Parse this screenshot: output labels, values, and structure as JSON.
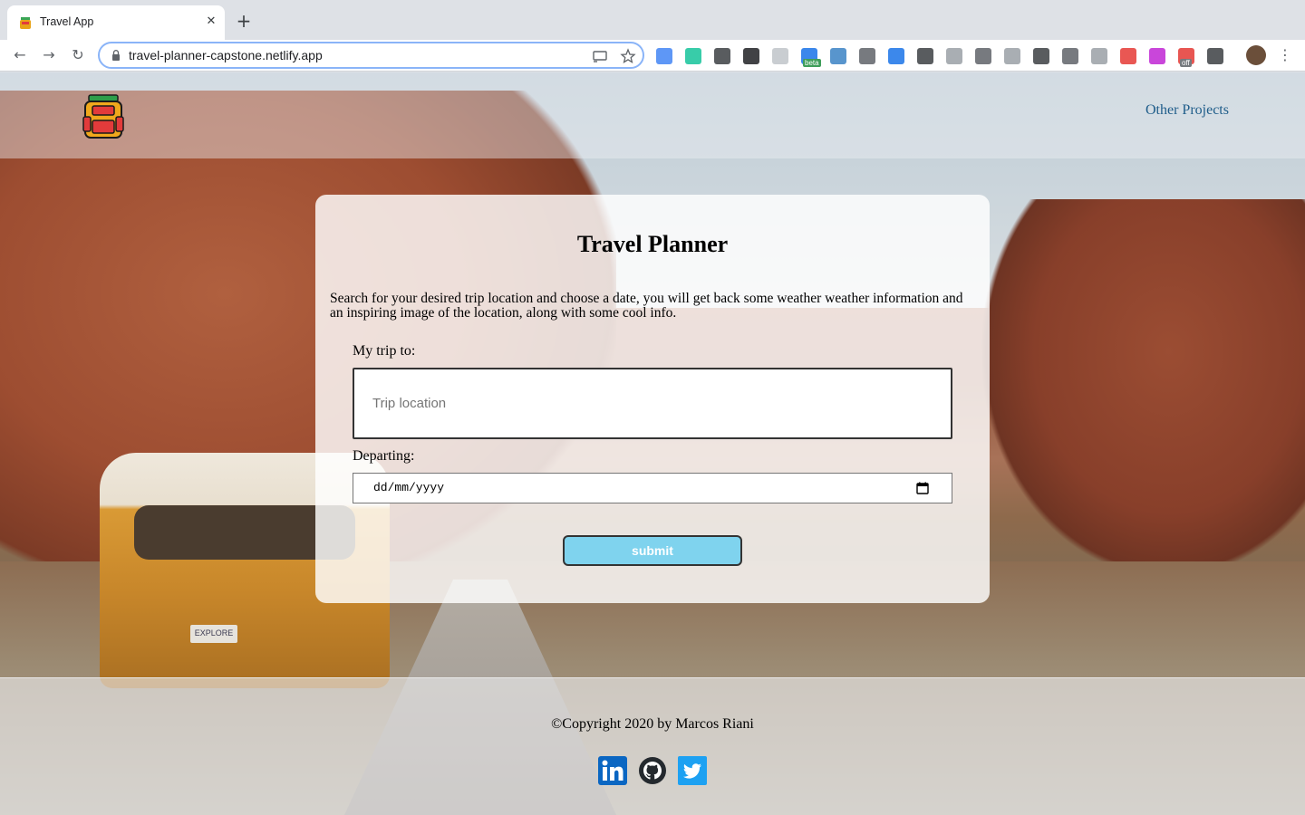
{
  "browser": {
    "tab_title": "Travel App",
    "tab_close_glyph": "✕",
    "new_tab_glyph": "+",
    "url": "travel-planner-capstone.netlify.app",
    "nav": {
      "back_glyph": "←",
      "forward_glyph": "→",
      "reload_glyph": "↻"
    },
    "extensions": [
      {
        "name": "google-translate-icon",
        "color": "#4285f4"
      },
      {
        "name": "grammarly-icon",
        "color": "#15c39a"
      },
      {
        "name": "screenshot-icon",
        "color": "#3c4043"
      },
      {
        "name": "whatfont-icon",
        "color": "#202124"
      },
      {
        "name": "grid-icon",
        "color": "#c0c4c9"
      },
      {
        "name": "beta-extension-icon",
        "color": "#1a73e8",
        "badge": "beta"
      },
      {
        "name": "safari-compass-icon",
        "color": "#3b82c4"
      },
      {
        "name": "books-icon",
        "color": "#5f6368"
      },
      {
        "name": "crop-icon",
        "color": "#1a73e8"
      },
      {
        "name": "eyedropper-icon",
        "color": "#3c4043"
      },
      {
        "name": "vue-devtools-icon",
        "color": "#9aa0a6"
      },
      {
        "name": "camera-icon",
        "color": "#5f6368"
      },
      {
        "name": "message-icon",
        "color": "#9aa0a6"
      },
      {
        "name": "reader-icon",
        "color": "#3c4043"
      },
      {
        "name": "bug-icon",
        "color": "#5f6368"
      },
      {
        "name": "page-ruler-icon",
        "color": "#9aa0a6"
      },
      {
        "name": "color-picker-icon",
        "color": "#e53935"
      },
      {
        "name": "purple-circle-icon",
        "color": "#c026d3"
      },
      {
        "name": "off-extension-icon",
        "color": "#e53935",
        "badge": "off"
      },
      {
        "name": "playlist-icon",
        "color": "#3c4043"
      }
    ]
  },
  "header": {
    "logo_name": "backpack-logo",
    "other_projects": "Other Projects"
  },
  "form": {
    "title": "Travel Planner",
    "description": "Search for your desired trip location and choose a date, you will get back some weather weather information and an inspiring image of the location, along with some cool info.",
    "trip_label": "My trip to:",
    "trip_placeholder": "Trip location",
    "trip_value": "",
    "departing_label": "Departing:",
    "date_placeholder": "dd/mm/yyyy",
    "submit_label": "submit"
  },
  "background": {
    "plate_text": "EXPLORE"
  },
  "footer": {
    "copyright": "©Copyright 2020 by Marcos Riani",
    "social": [
      {
        "name": "linkedin-icon",
        "color": "#0a66c2"
      },
      {
        "name": "github-icon",
        "color": "#24292e"
      },
      {
        "name": "twitter-icon",
        "color": "#1da1f2"
      }
    ]
  },
  "colors": {
    "link": "#1f5d8a",
    "submit_bg": "#7fd3ee",
    "card_bg": "rgba(255,255,255,0.82)"
  }
}
